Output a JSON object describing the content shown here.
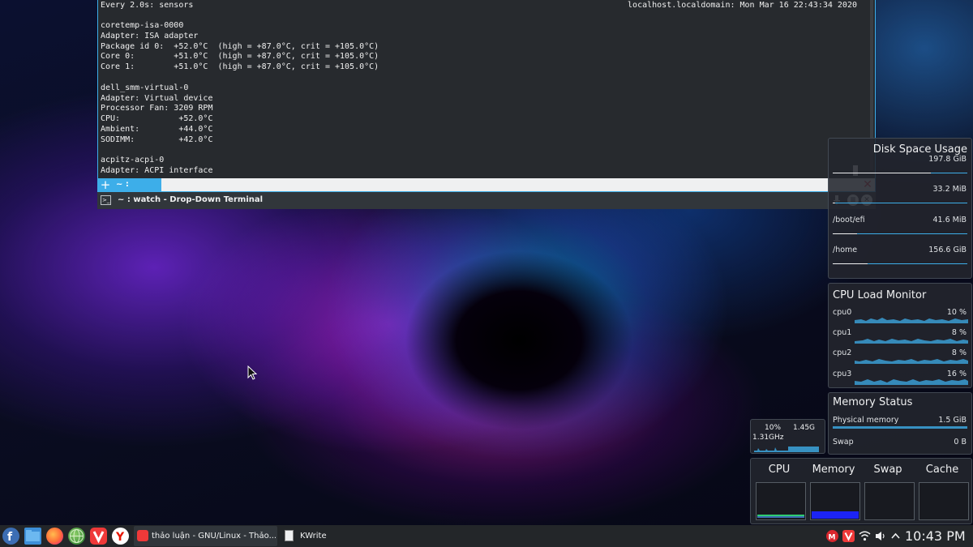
{
  "terminal": {
    "header_left": "Every 2.0s: sensors",
    "header_right": "localhost.localdomain: Mon Mar 16 22:43:34 2020",
    "lines": [
      "coretemp-isa-0000",
      "Adapter: ISA adapter",
      "Package id 0:  +52.0°C  (high = +87.0°C, crit = +105.0°C)",
      "Core 0:        +51.0°C  (high = +87.0°C, crit = +105.0°C)",
      "Core 1:        +51.0°C  (high = +87.0°C, crit = +105.0°C)",
      "",
      "dell_smm-virtual-0",
      "Adapter: Virtual device",
      "Processor Fan: 3209 RPM",
      "CPU:            +52.0°C",
      "Ambient:        +44.0°C",
      "SODIMM:         +42.0°C",
      "",
      "acpitz-acpi-0",
      "Adapter: ACPI interface"
    ],
    "tab_label": "~ : watch",
    "window_title": "~ : watch - Drop-Down Terminal"
  },
  "disk_widget": {
    "title": "Disk Space Usage",
    "rows": [
      {
        "label": "",
        "value": "197.8 GiB",
        "used_fraction": 0.73
      },
      {
        "label": "",
        "value": "33.2 MiB",
        "used_fraction": 0.02
      },
      {
        "label": "/boot/efi",
        "value": "41.6 MiB",
        "used_fraction": 0.18
      },
      {
        "label": "/home",
        "value": "156.6 GiB",
        "used_fraction": 0.26
      }
    ]
  },
  "cpu_widget": {
    "title": "CPU Load Monitor",
    "cores": [
      {
        "label": "cpu0",
        "value": "10 %"
      },
      {
        "label": "cpu1",
        "value": "8 %"
      },
      {
        "label": "cpu2",
        "value": "8 %"
      },
      {
        "label": "cpu3",
        "value": "16 %"
      }
    ]
  },
  "memory_widget": {
    "title": "Memory Status",
    "rows": [
      {
        "label": "Physical memory",
        "value": "1.5 GiB",
        "used_fraction": 0.2
      },
      {
        "label": "Swap",
        "value": "0 B",
        "used_fraction": 0
      }
    ]
  },
  "small_cpu": {
    "load": "10%",
    "max_freq": "1.45G",
    "freq": "1.31GHz"
  },
  "system_monitor": {
    "columns": [
      {
        "label": "CPU",
        "fill_fraction": 0.05
      },
      {
        "label": "Memory",
        "fill_fraction": 0.2
      },
      {
        "label": "Swap",
        "fill_fraction": 0
      },
      {
        "label": "Cache",
        "fill_fraction": 0
      }
    ]
  },
  "taskbar": {
    "tasks": [
      {
        "label": "thảo luận - GNU/Linux - Thảo..."
      },
      {
        "label": "KWrite"
      }
    ],
    "clock": "10:43 PM"
  },
  "colors": {
    "accent": "#3daee9",
    "panel": "#232629",
    "terminal_bg": "#272a2e",
    "memory_fill": "#1c24f5",
    "vivaldi_red": "#ef3939",
    "fedora_blue": "#3c6eb4"
  },
  "icons": {
    "launcher": "fedora-icon",
    "apps": [
      "file-manager-icon",
      "firefox-icon",
      "globe-browser-icon",
      "vivaldi-icon",
      "yandex-icon"
    ],
    "tray": [
      "mega-icon",
      "vivaldi-tray-icon",
      "wifi-icon",
      "volume-icon",
      "tray-expand-icon"
    ]
  }
}
